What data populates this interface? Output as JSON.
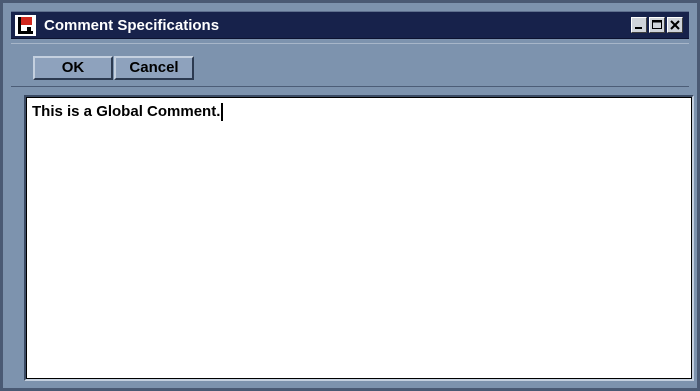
{
  "window": {
    "title": "Comment Specifications",
    "icon": "app-flag-icon",
    "controls": [
      "minimize-icon",
      "maximize-icon",
      "close-icon"
    ]
  },
  "toolbar": {
    "ok_label": "OK",
    "cancel_label": "Cancel"
  },
  "editor": {
    "value": "This is a Global Comment."
  },
  "colors": {
    "titlebar": "#17224b",
    "window_bg": "#7d93ae",
    "button_bg": "#8ea2bd",
    "editor_bg": "#ffffff"
  }
}
